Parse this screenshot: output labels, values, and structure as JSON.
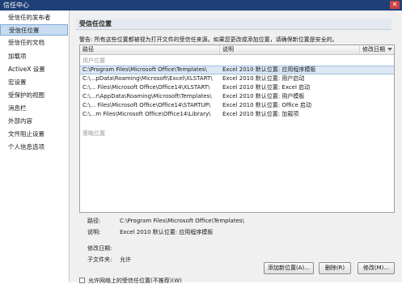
{
  "window": {
    "title": "信任中心",
    "close_glyph": "✕"
  },
  "sidebar": {
    "items": [
      {
        "label": "受信任的发布者",
        "active": false
      },
      {
        "label": "受信任位置",
        "active": true
      },
      {
        "label": "受信任的文档",
        "active": false
      },
      {
        "label": "加载项",
        "active": false
      },
      {
        "label": "ActiveX 设置",
        "active": false
      },
      {
        "label": "宏设置",
        "active": false
      },
      {
        "label": "受保护的视图",
        "active": false
      },
      {
        "label": "消息栏",
        "active": false
      },
      {
        "label": "外部内容",
        "active": false
      },
      {
        "label": "文件阻止设置",
        "active": false
      },
      {
        "label": "个人信息选项",
        "active": false
      }
    ]
  },
  "main": {
    "section_title": "受信任位置",
    "warning": "警告: 所有这些位置都被视为打开文件的受信任来源。如果您更改或添加位置，请确保新位置是安全的。",
    "columns": {
      "path": "路径",
      "description": "说明",
      "date_modified": "修改日期"
    },
    "user_group_label": "用户位置",
    "policy_group_label": "策略位置",
    "rows": [
      {
        "path": "C:\\Program Files\\Microsoft Office\\Templates\\",
        "description": "Excel 2010 默认位置: 应用程序模板",
        "selected": true
      },
      {
        "path": "C:\\...pData\\Roaming\\Microsoft\\Excel\\XLSTART\\",
        "description": "Excel 2010 默认位置: 用户启动",
        "selected": false
      },
      {
        "path": "C:\\... Files\\Microsoft Office\\Office14\\XLSTART\\",
        "description": "Excel 2010 默认位置: Excel 启动",
        "selected": false
      },
      {
        "path": "C:\\...r\\AppData\\Roaming\\Microsoft\\Templates\\",
        "description": "Excel 2010 默认位置: 用户模板",
        "selected": false
      },
      {
        "path": "C:\\... Files\\Microsoft Office\\Office14\\STARTUP\\",
        "description": "Excel 2010 默认位置: Office 启动",
        "selected": false
      },
      {
        "path": "C:\\...m Files\\Microsoft Office\\Office14\\Library\\",
        "description": "Excel 2010 默认位置: 加载项",
        "selected": false
      }
    ]
  },
  "details": {
    "path_label": "路径:",
    "path_value": "C:\\Program Files\\Microsoft Office\\Templates\\",
    "description_label": "说明:",
    "description_value": "Excel 2010 默认位置: 应用程序模板",
    "date_label": "修改日期:",
    "date_value": "",
    "subfolders_label": "子文件夹:",
    "subfolders_value": "允许"
  },
  "buttons": {
    "add": "添加新位置(A)...",
    "remove": "删除(R)",
    "modify": "修改(M)..."
  },
  "checkbox": {
    "label": "允许网络上的受信任位置(不推荐)(W)",
    "checked": false
  }
}
